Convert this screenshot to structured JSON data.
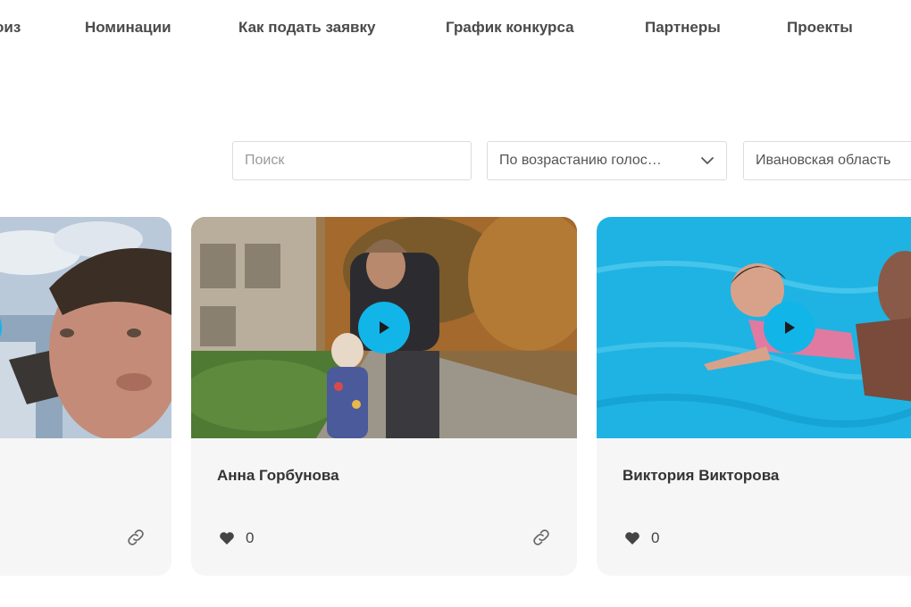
{
  "nav": {
    "items": [
      "оиз",
      "Номинации",
      "Как подать заявку",
      "График конкурса",
      "Партнеры",
      "Проекты"
    ]
  },
  "filters": {
    "search_placeholder": "Поиск",
    "sort_value": "По возрастанию голос…",
    "region_value": "Ивановская область"
  },
  "cards": [
    {
      "name": "",
      "likes": ""
    },
    {
      "name": "Анна Горбунова",
      "likes": "0"
    },
    {
      "name": "Виктория Викторова",
      "likes": "0"
    }
  ],
  "colors": {
    "accent": "#12b5e8",
    "card_bg": "#f6f6f6",
    "nav_text": "#4a4a4a"
  },
  "icons": [
    "play-icon",
    "heart-icon",
    "link-icon",
    "chevron-down-icon"
  ]
}
